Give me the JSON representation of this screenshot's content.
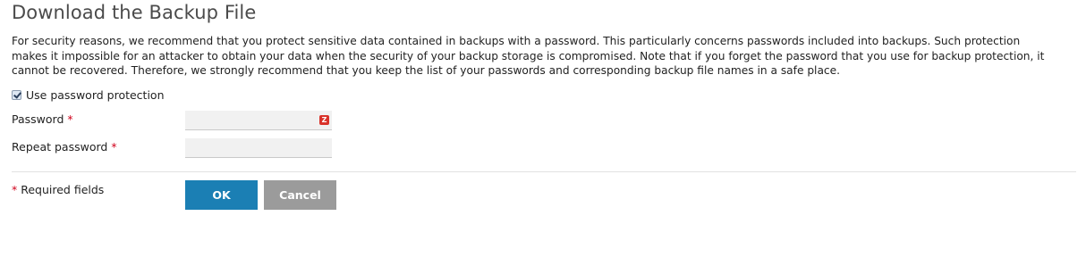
{
  "page": {
    "title": "Download the Backup File",
    "description": "For security reasons, we recommend that you protect sensitive data contained in backups with a password. This particularly concerns passwords included into backups. Such protection makes it impossible for an attacker to obtain your data when the security of your backup storage is compromised. Note that if you forget the password that you use for backup protection, it cannot be recovered. Therefore, we strongly recommend that you keep the list of your passwords and corresponding backup file names in a safe place."
  },
  "form": {
    "use_password_label": "Use password protection",
    "use_password_checked": true,
    "password_label": "Password",
    "repeat_password_label": "Repeat password",
    "required_marker": "*",
    "password_value": "",
    "repeat_password_value": "",
    "password_badge": "Z",
    "required_note_marker": "*",
    "required_note_text": " Required fields"
  },
  "buttons": {
    "ok_label": "OK",
    "cancel_label": "Cancel"
  },
  "colors": {
    "ok_button": "#1b7fb4",
    "cancel_button": "#9b9b9b",
    "required": "#d0021b",
    "badge": "#d9322a"
  }
}
